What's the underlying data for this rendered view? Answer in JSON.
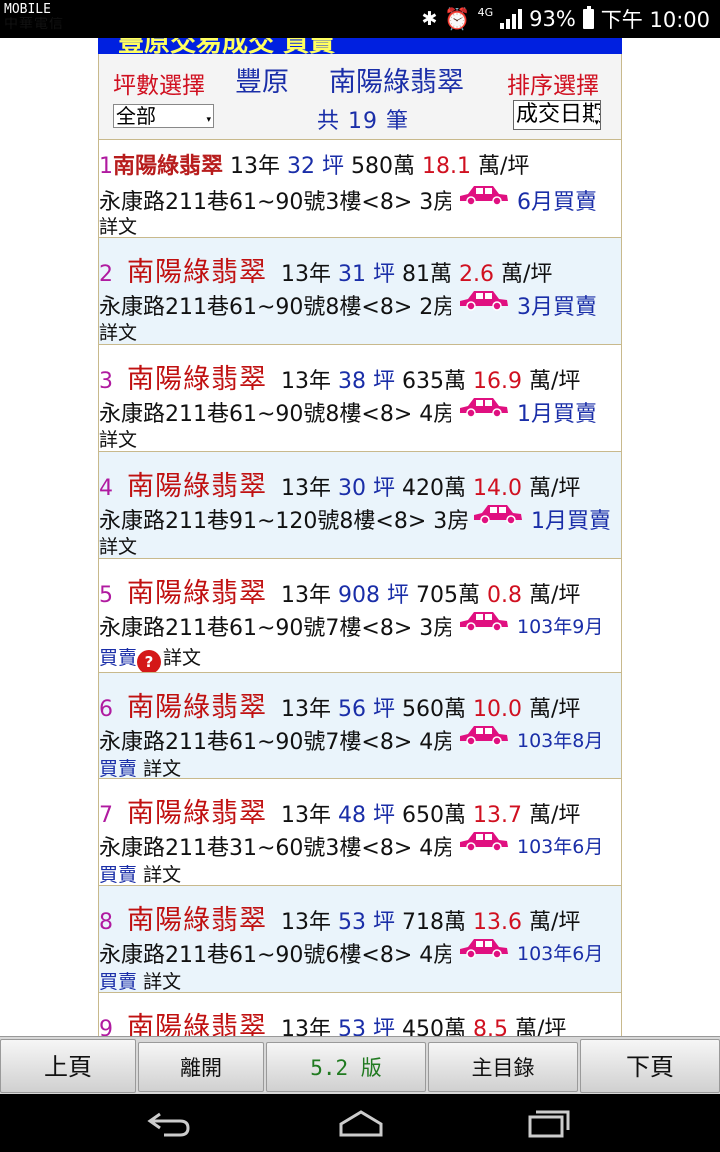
{
  "status": {
    "carrier_top": "MOBILE",
    "carrier_bottom": "中華電信",
    "network": "4G",
    "battery": "93%",
    "time": "下午 10:00"
  },
  "title_strip": "豐原交易成交 買賣",
  "header": {
    "area_label": "坪數選擇",
    "city": "豐原",
    "community": "南陽綠翡翠",
    "sort_label": "排序選擇",
    "area_value": "全部",
    "sort_value": "成交日期",
    "count": "共 19 筆"
  },
  "detail_label": "詳文",
  "listings": [
    {
      "idx": "1",
      "name": "南陽綠翡翠",
      "age": "13年",
      "ping": "32",
      "ping_unit": "坪",
      "price": "580萬",
      "unit_price": "18.1",
      "unit_label": "萬/坪",
      "address": "永康路211巷61~90號3樓<8> 3房",
      "deal_date": "6月買賣"
    },
    {
      "idx": "2",
      "name": "南陽綠翡翠",
      "age": "13年",
      "ping": "31",
      "ping_unit": "坪",
      "price": "81萬",
      "unit_price": "2.6",
      "unit_label": "萬/坪",
      "address": "永康路211巷61~90號8樓<8> 2房",
      "deal_date": "3月買賣"
    },
    {
      "idx": "3",
      "name": "南陽綠翡翠",
      "age": "13年",
      "ping": "38",
      "ping_unit": "坪",
      "price": "635萬",
      "unit_price": "16.9",
      "unit_label": "萬/坪",
      "address": "永康路211巷61~90號8樓<8> 4房",
      "deal_date": "1月買賣"
    },
    {
      "idx": "4",
      "name": "南陽綠翡翠",
      "age": "13年",
      "ping": "30",
      "ping_unit": "坪",
      "price": "420萬",
      "unit_price": "14.0",
      "unit_label": "萬/坪",
      "address": "永康路211巷91~120號8樓<8> 3房",
      "deal_date": "1月買賣"
    },
    {
      "idx": "5",
      "name": "南陽綠翡翠",
      "age": "13年",
      "ping": "908",
      "ping_unit": "坪",
      "price": "705萬",
      "unit_price": "0.8",
      "unit_label": "萬/坪",
      "address": "永康路211巷61~90號7樓<8> 3房",
      "deal_date": "103年9月",
      "deal_suffix": "買賣"
    },
    {
      "idx": "6",
      "name": "南陽綠翡翠",
      "age": "13年",
      "ping": "56",
      "ping_unit": "坪",
      "price": "560萬",
      "unit_price": "10.0",
      "unit_label": "萬/坪",
      "address": "永康路211巷61~90號7樓<8> 4房",
      "deal_date": "103年8月",
      "deal_suffix": "買賣"
    },
    {
      "idx": "7",
      "name": "南陽綠翡翠",
      "age": "13年",
      "ping": "48",
      "ping_unit": "坪",
      "price": "650萬",
      "unit_price": "13.7",
      "unit_label": "萬/坪",
      "address": "永康路211巷31~60號3樓<8> 4房",
      "deal_date": "103年6月",
      "deal_suffix": "買賣"
    },
    {
      "idx": "8",
      "name": "南陽綠翡翠",
      "age": "13年",
      "ping": "53",
      "ping_unit": "坪",
      "price": "718萬",
      "unit_price": "13.6",
      "unit_label": "萬/坪",
      "address": "永康路211巷61~90號6樓<8> 4房",
      "deal_date": "103年6月",
      "deal_suffix": "買賣"
    },
    {
      "idx": "9",
      "name": "南陽綠翡翠",
      "age": "13年",
      "ping": "53",
      "ping_unit": "坪",
      "price": "450萬",
      "unit_price": "8.5",
      "unit_label": "萬/坪"
    }
  ],
  "toolbar": {
    "prev": "上頁",
    "leave": "離開",
    "version": "5.2 版",
    "menu": "主目錄",
    "next": "下頁"
  },
  "colors": {
    "title_bg": "#0020e0",
    "row_alt": "#eaf4fb",
    "red": "#d01020",
    "blue": "#1a2ea8",
    "car": "#e01080"
  }
}
